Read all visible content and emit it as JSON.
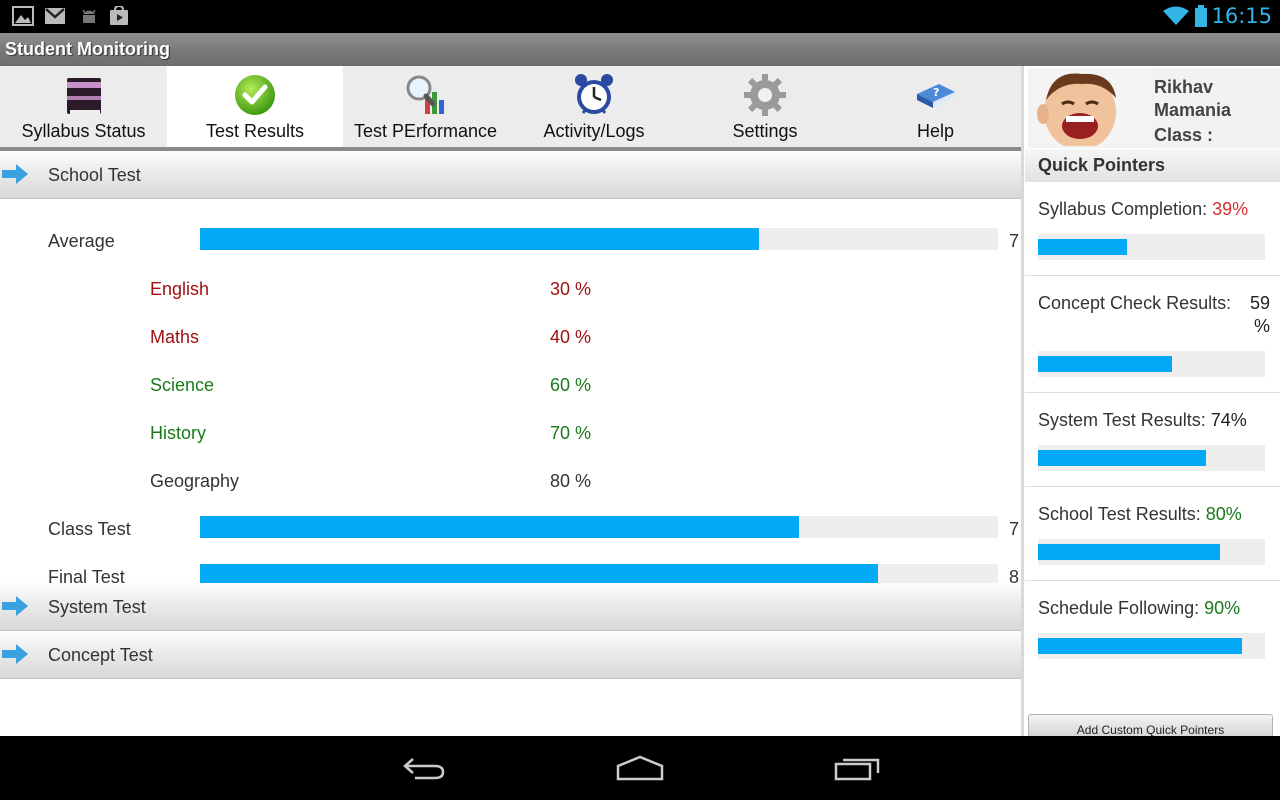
{
  "status_bar": {
    "time": "16:15",
    "left_icons": [
      "image-icon",
      "gmail-icon",
      "android-debug-icon",
      "play-store-icon"
    ],
    "right_icons": [
      "wifi-icon",
      "battery-icon"
    ],
    "accent_color": "#33b5e5"
  },
  "app": {
    "title": "Student Monitoring"
  },
  "tabs": [
    {
      "label": "Syllabus Status",
      "icon": "notebook-icon",
      "active": false
    },
    {
      "label": "Test Results",
      "icon": "green-check-icon",
      "active": true
    },
    {
      "label": "Test PErformance",
      "icon": "magnifier-chart-icon",
      "active": false
    },
    {
      "label": "Activity/Logs",
      "icon": "alarm-clock-icon",
      "active": false
    },
    {
      "label": "Settings",
      "icon": "gear-icon",
      "active": false
    },
    {
      "label": "Help",
      "icon": "help-book-icon",
      "active": false
    }
  ],
  "sections": {
    "school_test": {
      "label": "School Test",
      "average": {
        "label": "Average",
        "value_text": "7",
        "fill": 0.7
      },
      "subjects": [
        {
          "name": "English",
          "value": "30 %",
          "color": "#a01010"
        },
        {
          "name": "Maths",
          "value": "40 %",
          "color": "#a01010"
        },
        {
          "name": "Science",
          "value": "60 %",
          "color": "#1a7a1a"
        },
        {
          "name": "History",
          "value": "70 %",
          "color": "#1a7a1a"
        },
        {
          "name": "Geography",
          "value": "80 %",
          "color": "#333333"
        }
      ],
      "class_test": {
        "label": "Class Test",
        "value_text": "7",
        "fill": 0.75
      },
      "final_test": {
        "label": "Final Test",
        "value_text": "8",
        "fill": 0.85
      }
    },
    "system_test": {
      "label": "System Test"
    },
    "concept_test": {
      "label": "Concept Test"
    }
  },
  "profile": {
    "name": "Rikhav Mamania",
    "class_label": "Class :"
  },
  "quick_pointers": {
    "header": "Quick Pointers",
    "items": [
      {
        "label": "Syllabus Completion:",
        "value": "39%",
        "value_color": "#d32f2f",
        "fill": 0.39
      },
      {
        "label": "Concept Check Results:",
        "value": "59 %",
        "value_color": "#222222",
        "fill": 0.59
      },
      {
        "label": "System Test Results:",
        "value": "74%",
        "value_color": "#222222",
        "fill": 0.74
      },
      {
        "label": "School Test Results:",
        "value": "80%",
        "value_color": "#1a7a1a",
        "fill": 0.8
      },
      {
        "label": "Schedule Following:",
        "value": "90%",
        "value_color": "#1a7a1a",
        "fill": 0.9
      }
    ],
    "add_button": "Add Custom Quick Pointers"
  },
  "nav_bar": {
    "buttons": [
      "back-icon",
      "home-icon",
      "recent-apps-icon"
    ]
  }
}
